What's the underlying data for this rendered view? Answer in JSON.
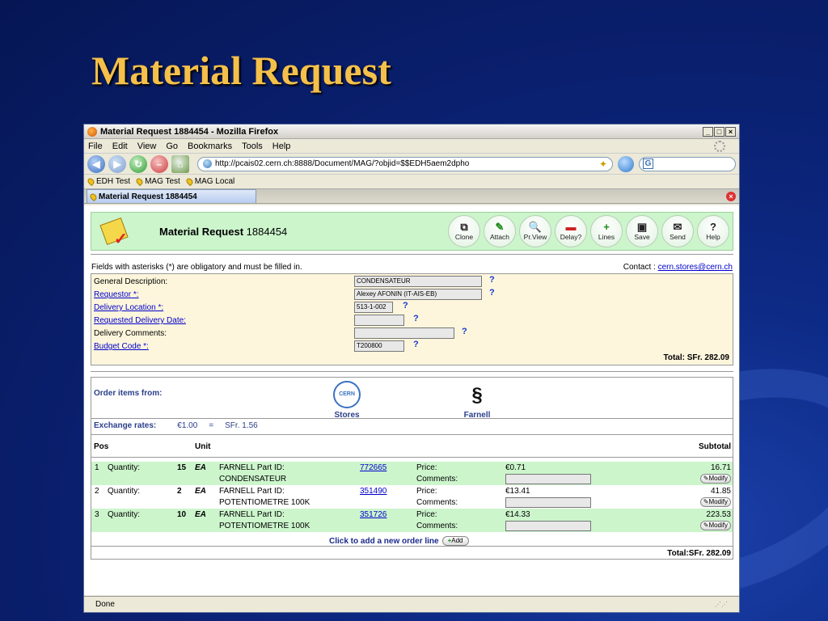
{
  "slide": {
    "title": "Material Request"
  },
  "browser": {
    "window_title": "Material Request 1884454 - Mozilla Firefox",
    "menu": [
      "File",
      "Edit",
      "View",
      "Go",
      "Bookmarks",
      "Tools",
      "Help"
    ],
    "url": "http://pcais02.cern.ch:8888/Document/MAG/?objid=$$EDH5aem2dpho",
    "search_value": "",
    "bookmarks": [
      "EDH Test",
      "MAG Test",
      "MAG Local"
    ],
    "tab_title": "Material Request 1884454",
    "status": "Done",
    "colors": {
      "slide_bg": "#0a2070",
      "title": "#f5c04a",
      "band": "#ccf5cc",
      "form_bg": "#fdf6dc"
    }
  },
  "page": {
    "title_bold": "Material Request",
    "request_number": "1884454",
    "toolbar": [
      {
        "label": "Clone",
        "icon": "clone-icon",
        "glyph": "⧉"
      },
      {
        "label": "Attach",
        "icon": "paperclip-icon",
        "glyph": "✎"
      },
      {
        "label": "Pr.View",
        "icon": "print-preview-icon",
        "glyph": "🔍"
      },
      {
        "label": "Delay?",
        "icon": "truck-icon",
        "glyph": "▬"
      },
      {
        "label": "Lines",
        "icon": "plus-icon",
        "glyph": "+"
      },
      {
        "label": "Save",
        "icon": "save-icon",
        "glyph": "▣"
      },
      {
        "label": "Send",
        "icon": "send-icon",
        "glyph": "✉"
      },
      {
        "label": "Help",
        "icon": "help-icon",
        "glyph": "?"
      }
    ],
    "obligatory_note": "Fields with asterisks (*) are obligatory and must be filled in.",
    "contact_label": "Contact : ",
    "contact_email": "cern.stores@cern.ch",
    "fields": {
      "general_description": {
        "label": "General Description:",
        "value": "CONDENSATEUR"
      },
      "requestor": {
        "label": "Requestor *:",
        "value": "Alexey AFONIN (IT-AIS-EB)"
      },
      "delivery_location": {
        "label": "Delivery Location *:",
        "value": "513-1-002"
      },
      "requested_delivery_date": {
        "label": "Requested Delivery Date:",
        "value": ""
      },
      "delivery_comments": {
        "label": "Delivery Comments:",
        "value": ""
      },
      "budget_code": {
        "label": "Budget Code *:",
        "value": "T200800"
      }
    },
    "total_top": "Total: SFr. 282.09",
    "order": {
      "from_label": "Order items from:",
      "stores_label": "Stores",
      "stores_logo": "CERN",
      "farnell_label": "Farnell",
      "exchange_label": "Exchange rates:",
      "exchange_from": "€1.00",
      "exchange_eq": "=",
      "exchange_to": "SFr. 1.56",
      "header_pos": "Pos",
      "header_unit": "Unit",
      "header_subtotal": "Subtotal",
      "items": [
        {
          "pos": "1",
          "qty_label": "Quantity:",
          "qty": "15",
          "unit": "EA",
          "part_label": "FARNELL Part ID:",
          "desc": "CONDENSATEUR",
          "part_id": "772665",
          "price_label": "Price:",
          "comments_label": "Comments:",
          "price": "€0.71",
          "subtotal": "16.71",
          "modify": "Modify"
        },
        {
          "pos": "2",
          "qty_label": "Quantity:",
          "qty": "2",
          "unit": "EA",
          "part_label": "FARNELL Part ID:",
          "desc": "POTENTIOMETRE 100K",
          "part_id": "351490",
          "price_label": "Price:",
          "comments_label": "Comments:",
          "price": "€13.41",
          "subtotal": "41.85",
          "modify": "Modify"
        },
        {
          "pos": "3",
          "qty_label": "Quantity:",
          "qty": "10",
          "unit": "EA",
          "part_label": "FARNELL Part ID:",
          "desc": "POTENTIOMETRE 100K",
          "part_id": "351726",
          "price_label": "Price:",
          "comments_label": "Comments:",
          "price": "€14.33",
          "subtotal": "223.53",
          "modify": "Modify"
        }
      ],
      "add_line_text": "Click to add a new order line",
      "add_button": "Add",
      "total_bottom": "Total:SFr. 282.09"
    }
  }
}
